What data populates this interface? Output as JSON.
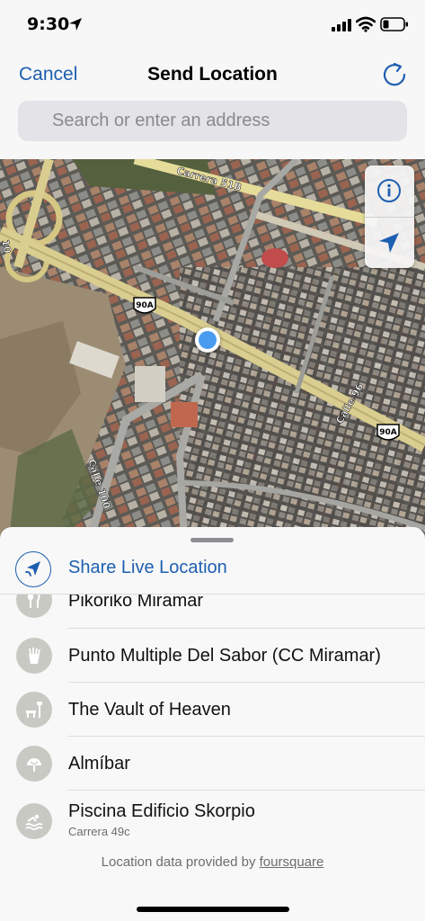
{
  "status_bar": {
    "time": "9:30"
  },
  "nav": {
    "cancel_label": "Cancel",
    "title": "Send Location"
  },
  "search": {
    "placeholder": "Search or enter an address"
  },
  "map": {
    "labels": {
      "carrera_51b": "Carrera 51B",
      "calle_96": "Calle 96",
      "calle_100": "Calle 100",
      "shield_left": "90A",
      "shield_right": "90A",
      "edge_label": "10"
    }
  },
  "sheet": {
    "share_live_label": "Share Live Location",
    "places": [
      {
        "name": "Pikoriko Miramar",
        "icon": "utensils-icon"
      },
      {
        "name": "Punto Multiple Del Sabor (CC Miramar)",
        "icon": "fries-icon"
      },
      {
        "name": "The Vault of Heaven",
        "icon": "bench-lamp-icon"
      },
      {
        "name": "Almíbar",
        "icon": "dessert-icon"
      },
      {
        "name": "Piscina Edificio Skorpio",
        "subtitle": "Carrera 49c",
        "icon": "pool-icon"
      }
    ],
    "attribution_prefix": "Location data provided by",
    "attribution_link": "foursquare"
  },
  "colors": {
    "accent": "#1d5fb0",
    "user_dot": "#4a9cf0",
    "icon_circle": "#c9c9c4"
  }
}
